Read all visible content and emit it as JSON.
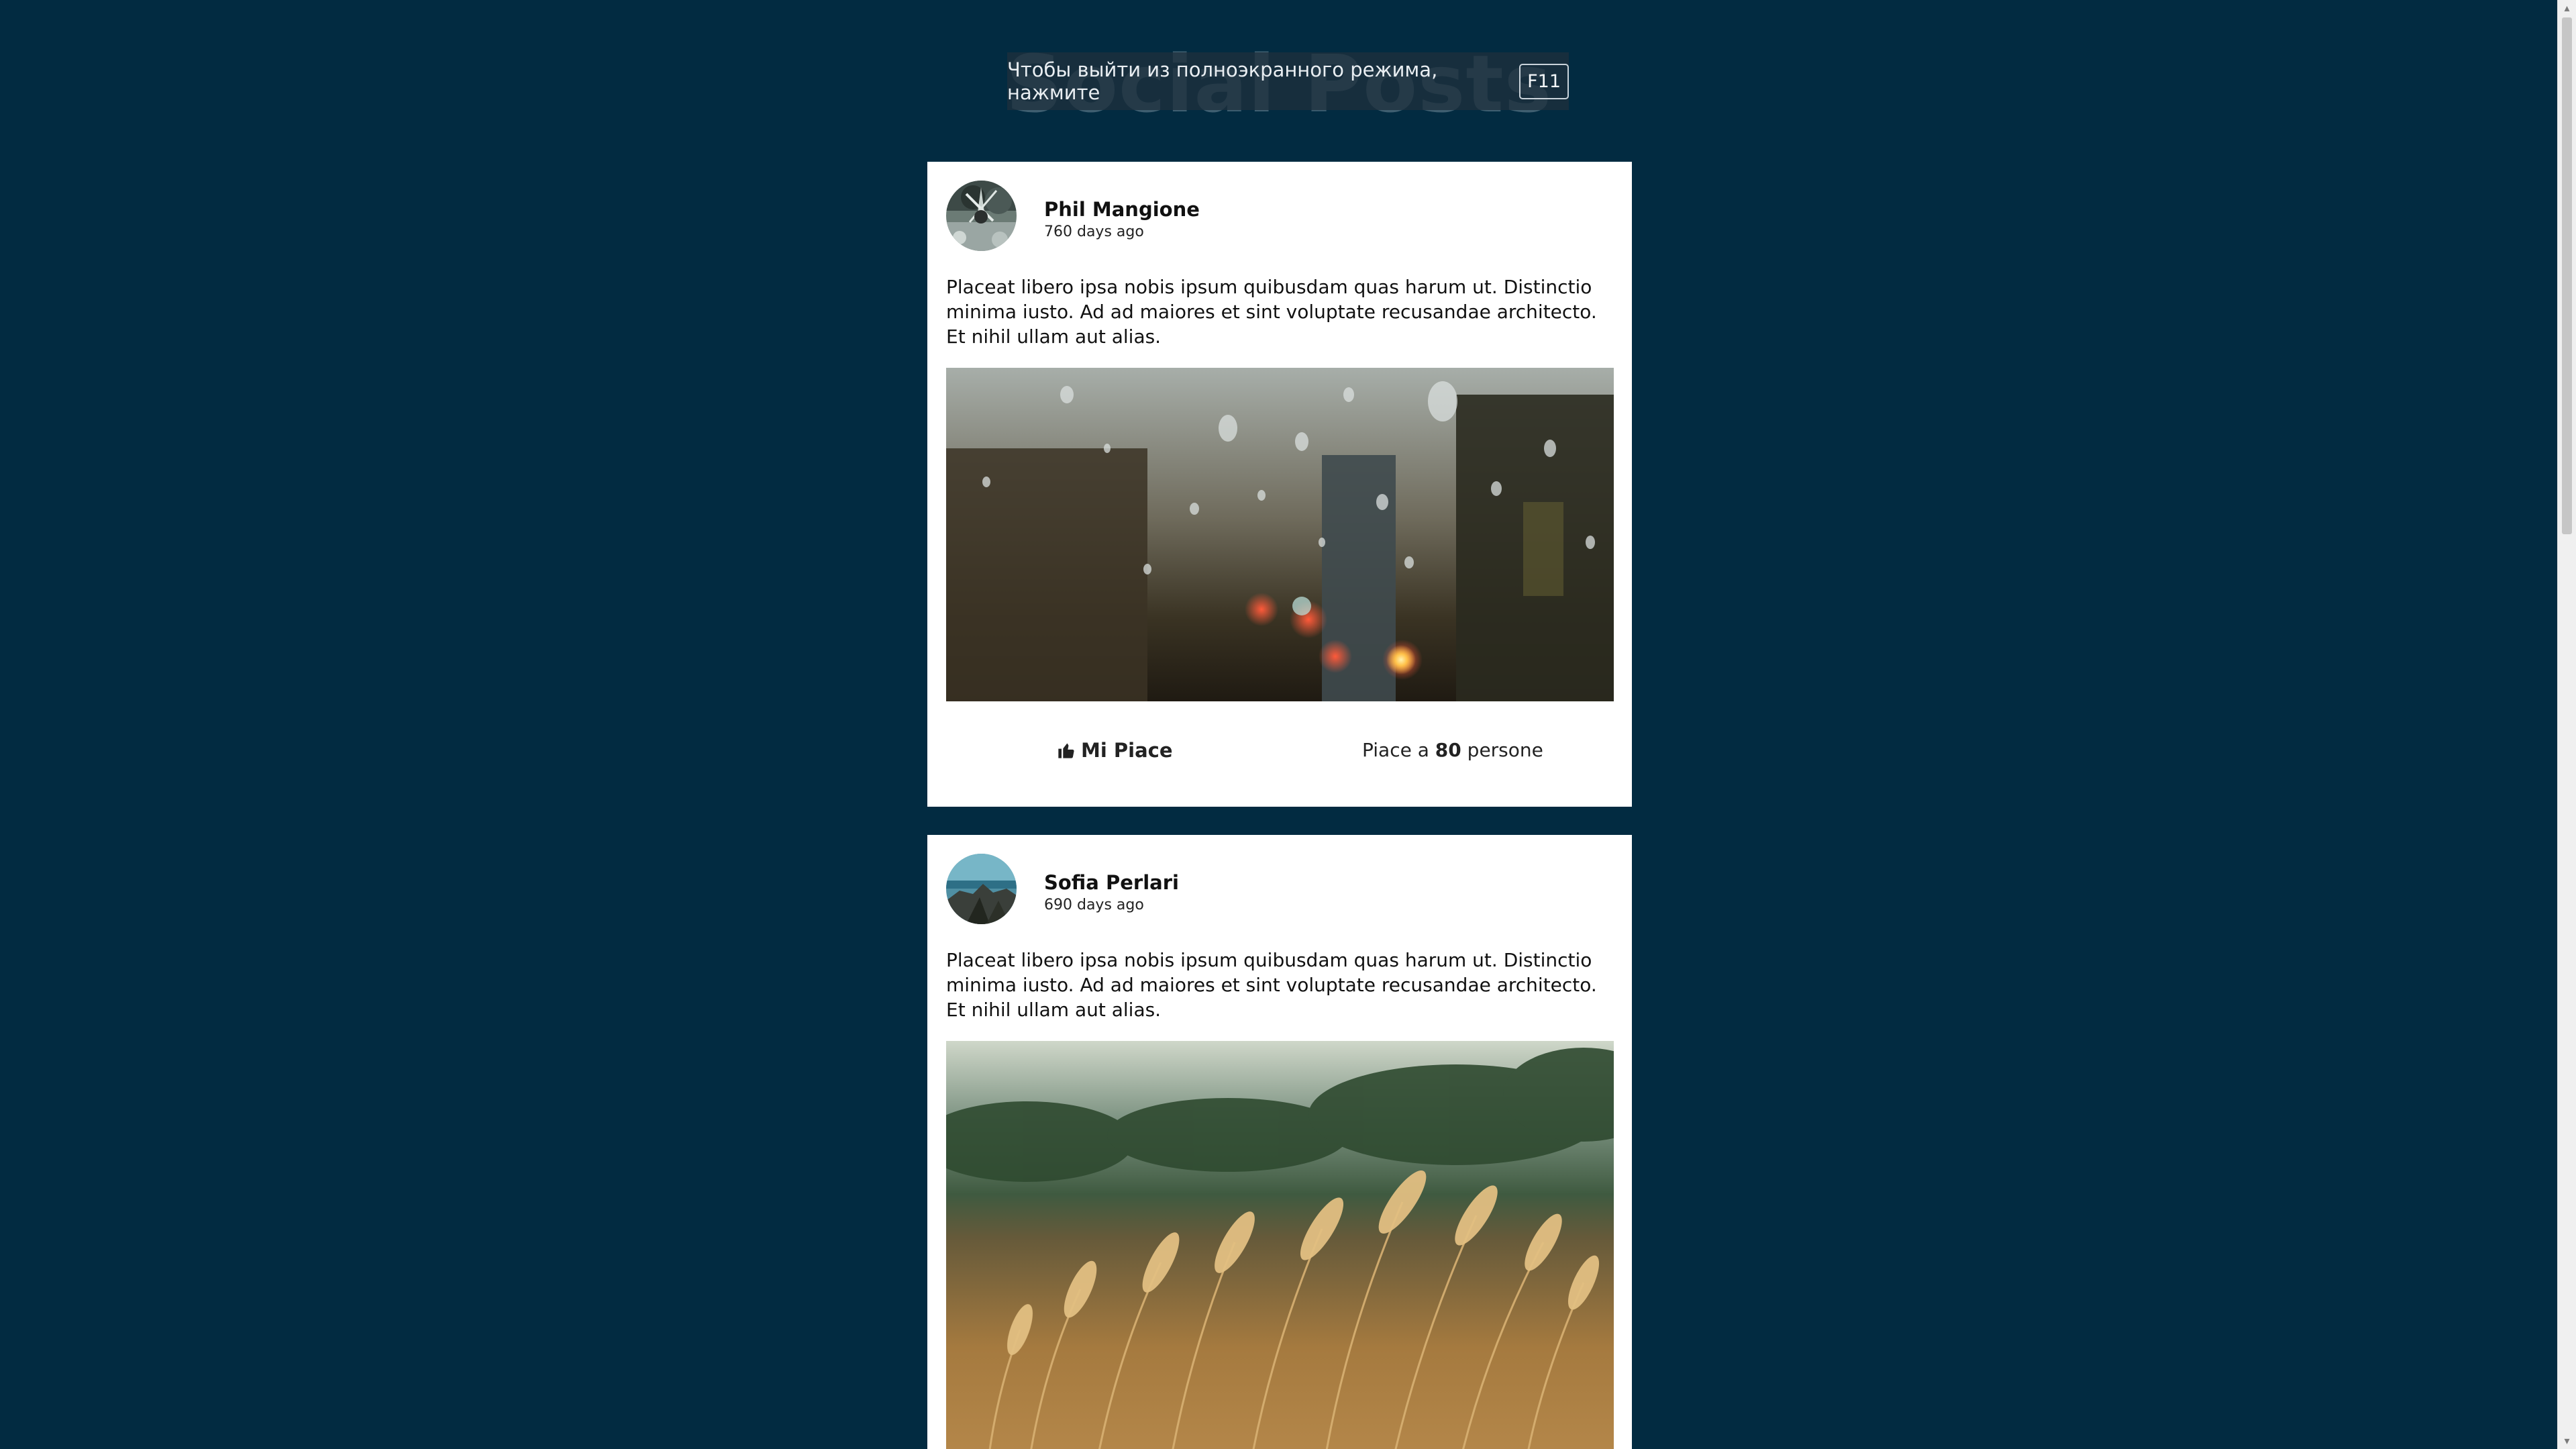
{
  "page": {
    "title": "Social Posts"
  },
  "fullscreen_notice": {
    "text": "Чтобы выйти из полноэкранного режима, нажмите",
    "key": "F11"
  },
  "posts": [
    {
      "author": "Phil Mangione",
      "time": "760 days ago",
      "text": "Placeat libero ipsa nobis ipsum quibusdam quas harum ut. Distinctio minima iusto. Ad ad maiores et sint voluptate recusandae architecto. Et nihil ullam aut alias.",
      "like_label": "Mi Piace",
      "likes_prefix": "Piace a",
      "likes": "80",
      "likes_suffix": "persone"
    },
    {
      "author": "Sofia Perlari",
      "time": "690 days ago",
      "text": "Placeat libero ipsa nobis ipsum quibusdam quas harum ut. Distinctio minima iusto. Ad ad maiores et sint voluptate recusandae architecto. Et nihil ullam aut alias."
    }
  ],
  "icons": {
    "like": "thumbs-up-icon"
  },
  "colors": {
    "background": "#022b41",
    "card": "#ffffff"
  }
}
